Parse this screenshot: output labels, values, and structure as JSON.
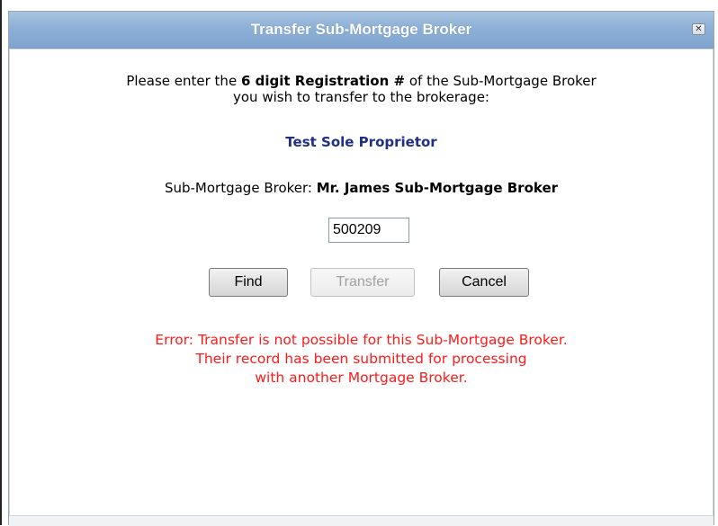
{
  "dialog": {
    "title": "Transfer Sub-Mortgage Broker",
    "close_icon": "close-icon",
    "close_label": "✕"
  },
  "instructions": {
    "prefix": "Please enter the ",
    "bold": "6 digit Registration #",
    "suffix": " of the Sub-Mortgage Broker",
    "line2": "you wish to transfer to the brokerage:"
  },
  "brokerage": {
    "name": "Test Sole Proprietor"
  },
  "broker": {
    "label": "Sub-Mortgage Broker:",
    "name": "Mr. James Sub-Mortgage Broker"
  },
  "registration": {
    "value": "500209"
  },
  "buttons": {
    "find": "Find",
    "transfer": "Transfer",
    "cancel": "Cancel"
  },
  "error": {
    "line1": "Error: Transfer is not possible for this Sub-Mortgage Broker.",
    "line2": "Their record has been submitted for processing",
    "line3": "with another Mortgage Broker."
  },
  "colors": {
    "titlebar": "#8db0d6",
    "brokerage_name": "#1f2f86",
    "error": "#ff1a1a"
  }
}
